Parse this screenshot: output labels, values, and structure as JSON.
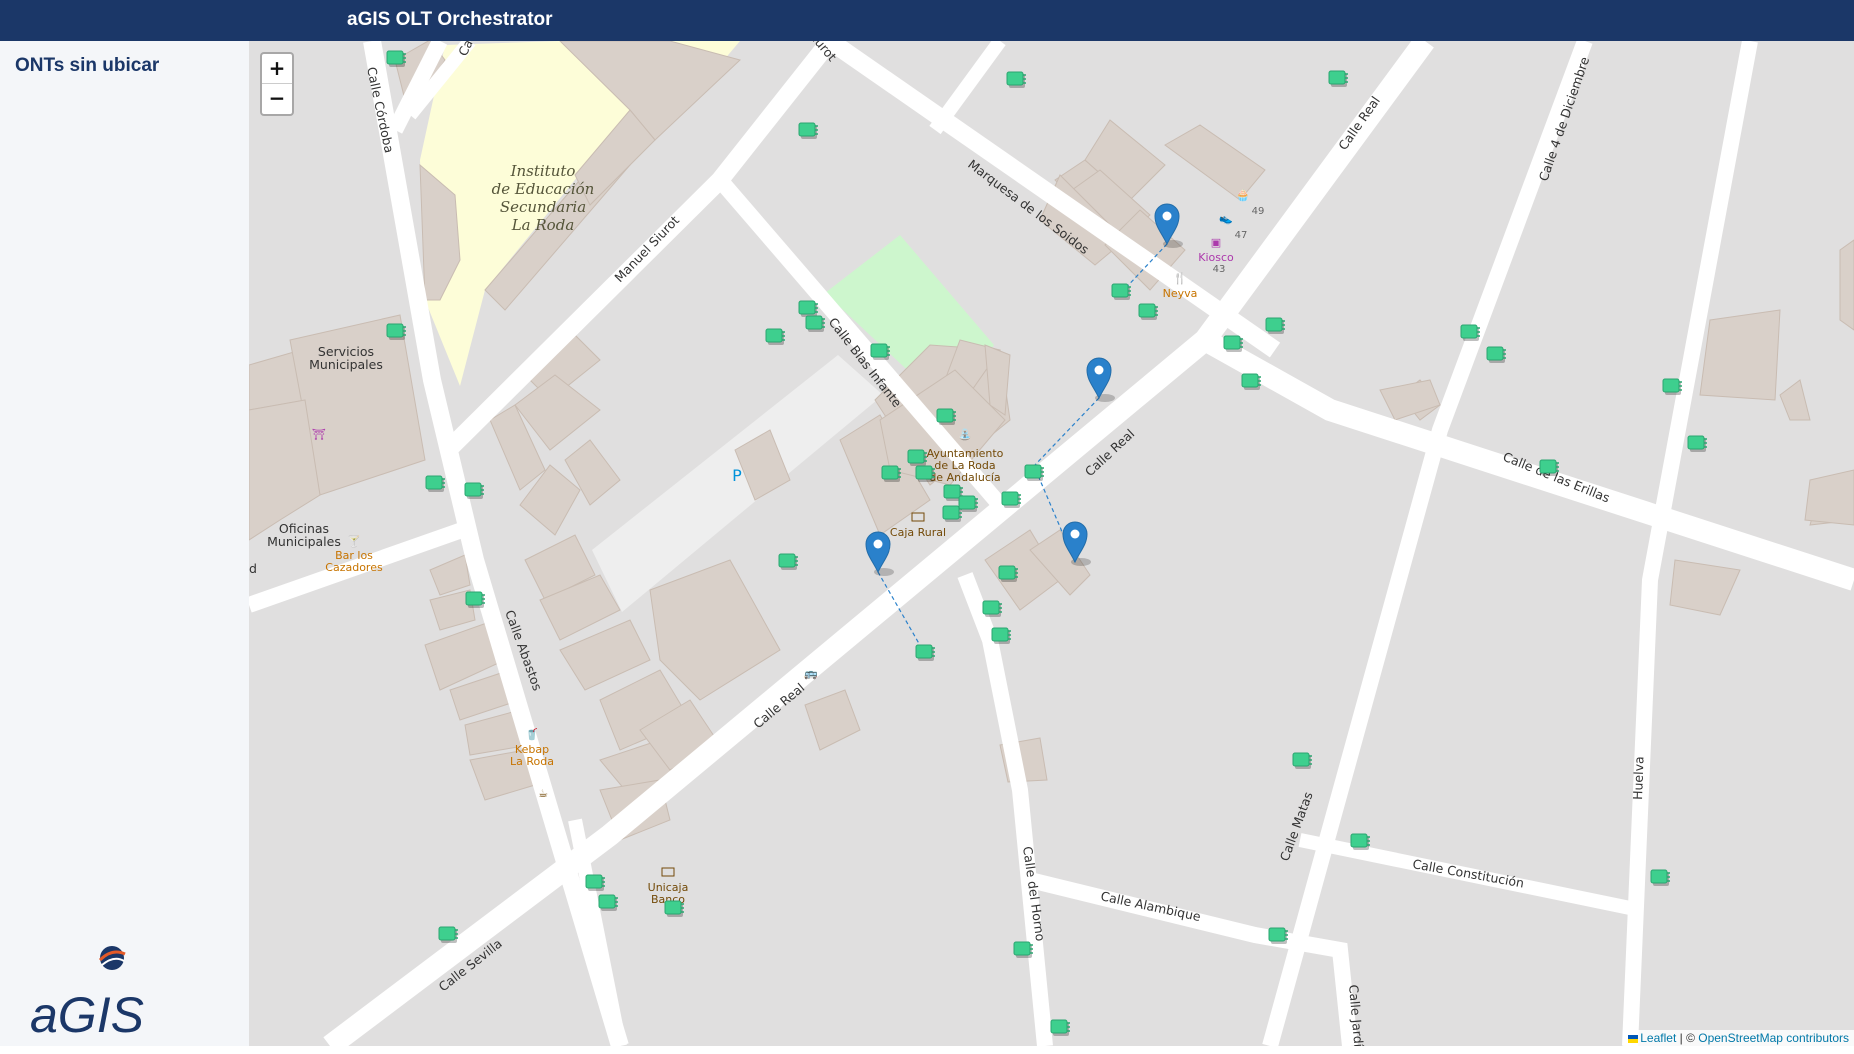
{
  "header": {
    "title": "aGIS OLT Orchestrator"
  },
  "sidebar": {
    "heading": "ONTs sin ubicar",
    "logo_text": "aGIS"
  },
  "map": {
    "zoom_in_label": "+",
    "zoom_out_label": "−",
    "attribution": {
      "leaflet": "Leaflet",
      "separator": " | © ",
      "osm": "OpenStreetMap contributors"
    },
    "street_labels": {
      "calle_cordoba": "Calle Córdoba",
      "calle_top": "Calle",
      "surot": "iurot",
      "manuel_siurot": "Manuel Siurot",
      "marquesa": "Marquesa de los Soidos",
      "calle_real_1": "Calle Real",
      "calle_real_2": "Calle Real",
      "calle_real_3": "Calle Real",
      "calle_4_dic": "Calle 4 de Diciembre",
      "calle_blas": "Calle Blas Infante",
      "calle_erillas": "Calle de las Erillas",
      "calle_abastos": "Calle Abastos",
      "calle_sevilla": "Calle Sevilla",
      "calle_horno": "Calle del Horno",
      "calle_alambique": "Calle Alambique",
      "calle_matas": "Calle Matas",
      "calle_constitucion": "Calle Constitución",
      "huelva": "Huelva",
      "calle_jardin": "Calle Jardín",
      "d": "d"
    },
    "area_labels": {
      "instituto_1": "Instituto",
      "instituto_2": "de Educación",
      "instituto_3": "Secundaria",
      "instituto_4": "La Roda",
      "servicios_1": "Servicios",
      "servicios_2": "Municipales",
      "oficinas_1": "Oficinas",
      "oficinas_2": "Municipales",
      "parking": "P"
    },
    "poi_labels": {
      "bar_1": "Bar los",
      "bar_2": "Cazadores",
      "ayto_1": "Ayuntamiento",
      "ayto_2": "de La Roda",
      "ayto_3": "de Andalucía",
      "caja_rural": "Caja Rural",
      "kebab_1": "Kebap",
      "kebab_2": "La Roda",
      "unicaja_1": "Unicaja",
      "unicaja_2": "Banco",
      "kiosco": "Kiosco",
      "neyva": "Neyva",
      "num_49": "49",
      "num_47": "47",
      "num_43": "43"
    },
    "colors": {
      "ont": "#3ecf8e",
      "pin": "#2a81cb",
      "link": "#2a81cb",
      "topbar": "#1b3768"
    }
  }
}
